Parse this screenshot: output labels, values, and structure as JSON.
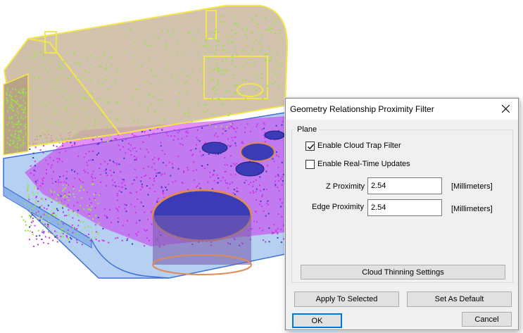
{
  "dialog": {
    "title": "Geometry Relationship Proximity Filter",
    "close_icon": "close-icon",
    "group_label": "Plane",
    "enable_cloud_trap_filter": {
      "label": "Enable Cloud Trap Filter",
      "checked": true
    },
    "enable_realtime_updates": {
      "label": "Enable Real-Time Updates",
      "checked": false
    },
    "z_proximity": {
      "label": "Z Proximity",
      "value": "2.54",
      "units": "[Millimeters]"
    },
    "edge_proximity": {
      "label": "Edge Proximity",
      "value": "2.54",
      "units": "[Millimeters]"
    },
    "cloud_thinning_button": "Cloud Thinning Settings",
    "apply_button": "Apply To Selected",
    "set_default_button": "Set As Default",
    "ok_button": "OK",
    "cancel_button": "Cancel"
  },
  "colors": {
    "upper_body": "#c8b49a",
    "upper_outline": "#f2e64a",
    "lower_body": "#9ec0ec",
    "lower_outline": "#3f6fd9",
    "cloud_magenta": "#cc33ee",
    "cloud_green": "#9be24a",
    "cloud_blue": "#3a3acc",
    "hole_fill": "#3b3bb8",
    "hole_rim": "#e08a55",
    "default_button_border": "#0078d7"
  }
}
